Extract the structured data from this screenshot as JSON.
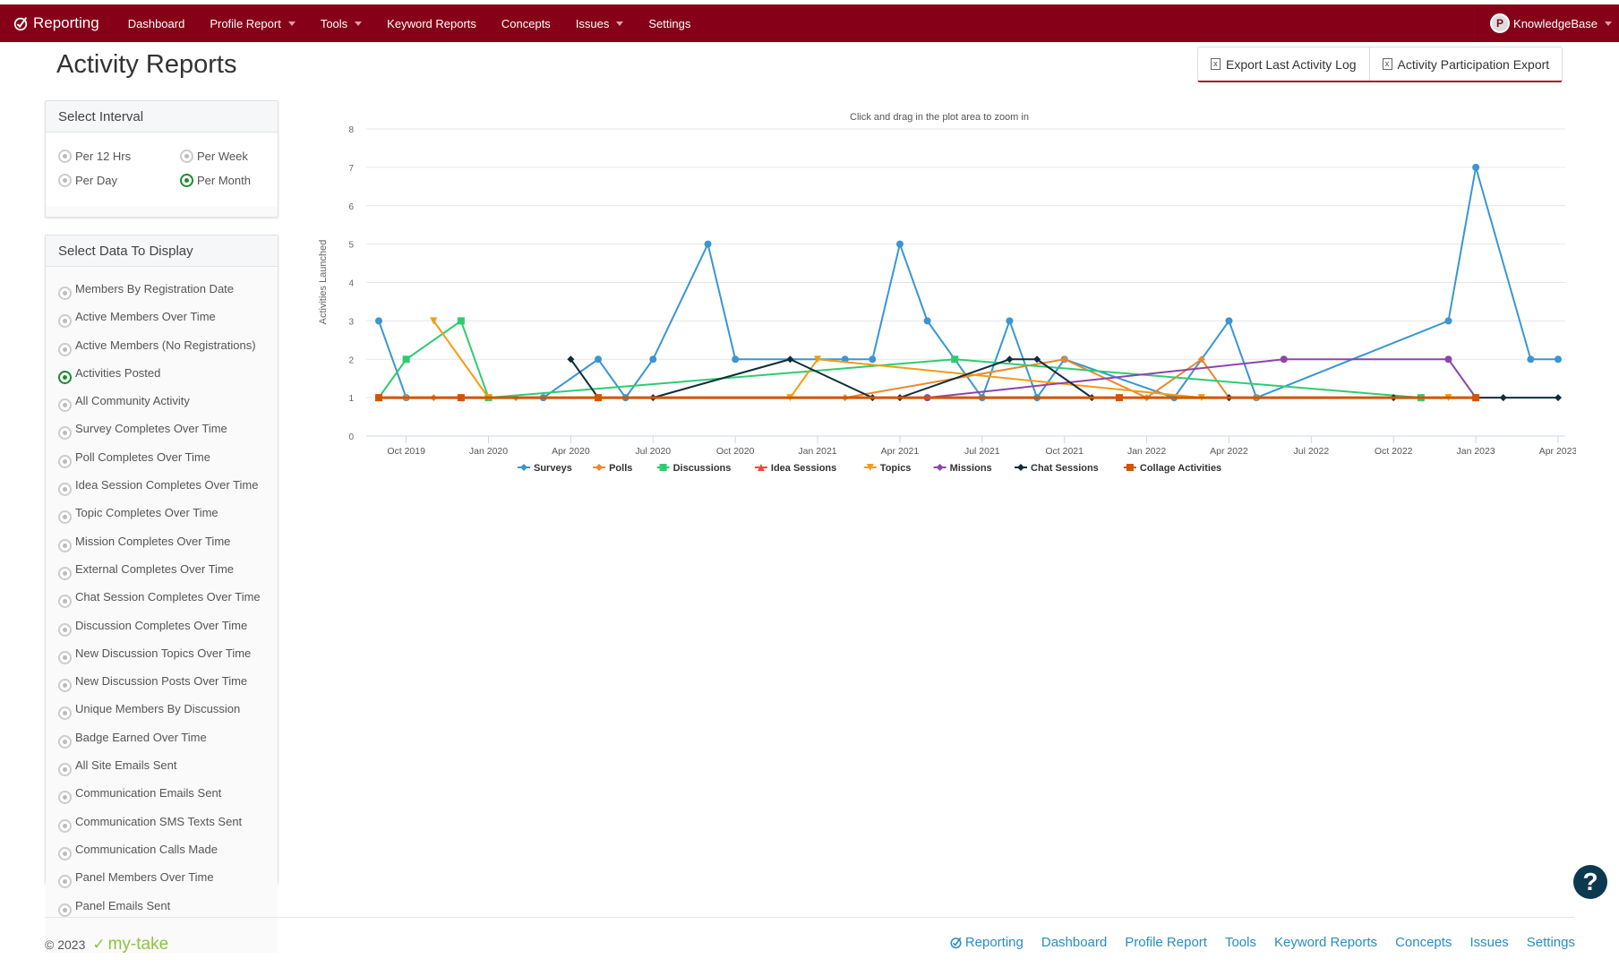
{
  "header": {
    "brand": "Reporting",
    "nav": [
      {
        "label": "Dashboard",
        "dropdown": false
      },
      {
        "label": "Profile Report",
        "dropdown": true
      },
      {
        "label": "Tools",
        "dropdown": true
      },
      {
        "label": "Keyword Reports",
        "dropdown": false
      },
      {
        "label": "Concepts",
        "dropdown": false
      },
      {
        "label": "Issues",
        "dropdown": true
      },
      {
        "label": "Settings",
        "dropdown": false
      }
    ],
    "user": "KnowledgeBase",
    "colors": {
      "bar": "#860018"
    }
  },
  "page": {
    "title": "Activity Reports",
    "export_last_activity": "Export Last Activity Log",
    "activity_participation_export": "Activity Participation Export"
  },
  "interval": {
    "title": "Select Interval",
    "options": [
      {
        "label": "Per 12 Hrs",
        "selected": false
      },
      {
        "label": "Per Week",
        "selected": false
      },
      {
        "label": "Per Day",
        "selected": false
      },
      {
        "label": "Per Month",
        "selected": true
      }
    ]
  },
  "data_select": {
    "title": "Select Data To Display",
    "options": [
      {
        "label": "Members By Registration Date",
        "selected": false
      },
      {
        "label": "Active Members Over Time",
        "selected": false
      },
      {
        "label": "Active Members (No Registrations)",
        "selected": false
      },
      {
        "label": "Activities Posted",
        "selected": true
      },
      {
        "label": "All Community Activity",
        "selected": false
      },
      {
        "label": "Survey Completes Over Time",
        "selected": false
      },
      {
        "label": "Poll Completes Over Time",
        "selected": false
      },
      {
        "label": "Idea Session Completes Over Time",
        "selected": false
      },
      {
        "label": "Topic Completes Over Time",
        "selected": false
      },
      {
        "label": "Mission Completes Over Time",
        "selected": false
      },
      {
        "label": "External Completes Over Time",
        "selected": false
      },
      {
        "label": "Chat Session Completes Over Time",
        "selected": false
      },
      {
        "label": "Discussion Completes Over Time",
        "selected": false
      },
      {
        "label": "New Discussion Topics Over Time",
        "selected": false
      },
      {
        "label": "New Discussion Posts Over Time",
        "selected": false
      },
      {
        "label": "Unique Members By Discussion",
        "selected": false
      },
      {
        "label": "Badge Earned Over Time",
        "selected": false
      },
      {
        "label": "All Site Emails Sent",
        "selected": false
      },
      {
        "label": "Communication Emails Sent",
        "selected": false
      },
      {
        "label": "Communication SMS Texts Sent",
        "selected": false
      },
      {
        "label": "Communication Calls Made",
        "selected": false
      },
      {
        "label": "Panel Members Over Time",
        "selected": false
      },
      {
        "label": "Panel Emails Sent",
        "selected": false
      }
    ]
  },
  "chart_data": {
    "type": "line",
    "title": "",
    "subtitle": "Click and drag in the plot area to zoom in",
    "xlabel": "",
    "ylabel": "Activities Launched",
    "ylim": [
      0,
      8
    ],
    "yticks": [
      0,
      1,
      2,
      3,
      4,
      5,
      6,
      7,
      8
    ],
    "x_start": "Sep 2019",
    "x_end": "Apr 2023",
    "x_unit": "month index from Sep 2019 (0) to Apr 2023 (43)",
    "xrange": [
      0,
      43
    ],
    "xticks": [
      {
        "label": "Oct 2019",
        "x": 1
      },
      {
        "label": "Jan 2020",
        "x": 4
      },
      {
        "label": "Apr 2020",
        "x": 7
      },
      {
        "label": "Jul 2020",
        "x": 10
      },
      {
        "label": "Oct 2020",
        "x": 13
      },
      {
        "label": "Jan 2021",
        "x": 16
      },
      {
        "label": "Apr 2021",
        "x": 19
      },
      {
        "label": "Jul 2021",
        "x": 22
      },
      {
        "label": "Oct 2021",
        "x": 25
      },
      {
        "label": "Jan 2022",
        "x": 28
      },
      {
        "label": "Apr 2022",
        "x": 31
      },
      {
        "label": "Jul 2022",
        "x": 34
      },
      {
        "label": "Oct 2022",
        "x": 37
      },
      {
        "label": "Jan 2023",
        "x": 40
      },
      {
        "label": "Apr 2023",
        "x": 43
      }
    ],
    "grid": true,
    "legend_position": "bottom",
    "series": [
      {
        "name": "Surveys",
        "color": "#3a96d2",
        "marker": "circle",
        "points": [
          [
            0,
            3
          ],
          [
            1,
            1
          ],
          [
            6,
            1
          ],
          [
            8,
            2
          ],
          [
            9,
            1
          ],
          [
            10,
            2
          ],
          [
            12,
            5
          ],
          [
            13,
            2
          ],
          [
            17,
            2
          ],
          [
            18,
            2
          ],
          [
            19,
            5
          ],
          [
            20,
            3
          ],
          [
            22,
            1
          ],
          [
            23,
            3
          ],
          [
            24,
            1
          ],
          [
            25,
            2
          ],
          [
            29,
            1
          ],
          [
            31,
            3
          ],
          [
            32,
            1
          ],
          [
            39,
            3
          ],
          [
            40,
            7
          ],
          [
            42,
            2
          ],
          [
            43,
            2
          ]
        ]
      },
      {
        "name": "Polls",
        "color": "#e8892f",
        "marker": "diamond",
        "points": [
          [
            1,
            1
          ],
          [
            2,
            1
          ],
          [
            5,
            1
          ],
          [
            17,
            1
          ],
          [
            25,
            2
          ],
          [
            28,
            1
          ],
          [
            30,
            2
          ],
          [
            31,
            1
          ],
          [
            32,
            1
          ]
        ]
      },
      {
        "name": "Discussions",
        "color": "#2ecc71",
        "marker": "square",
        "points": [
          [
            0,
            1
          ],
          [
            1,
            2
          ],
          [
            3,
            3
          ],
          [
            4,
            1
          ],
          [
            21,
            2
          ],
          [
            38,
            1
          ]
        ]
      },
      {
        "name": "Idea Sessions",
        "color": "#e74c3c",
        "marker": "triangle",
        "points": []
      },
      {
        "name": "Topics",
        "color": "#f39c12",
        "marker": "triangle-down",
        "points": [
          [
            2,
            3
          ],
          [
            4,
            1
          ],
          [
            15,
            1
          ],
          [
            16,
            2
          ],
          [
            30,
            1
          ],
          [
            39,
            1
          ]
        ]
      },
      {
        "name": "Missions",
        "color": "#8e44ad",
        "marker": "circle",
        "points": [
          [
            20,
            1
          ],
          [
            33,
            2
          ],
          [
            39,
            2
          ],
          [
            40,
            1
          ]
        ]
      },
      {
        "name": "Chat Sessions",
        "color": "#0f2e3d",
        "marker": "diamond",
        "points": [
          [
            7,
            2
          ],
          [
            8,
            1
          ],
          [
            10,
            1
          ],
          [
            15,
            2
          ],
          [
            18,
            1
          ],
          [
            19,
            1
          ],
          [
            23,
            2
          ],
          [
            24,
            2
          ],
          [
            26,
            1
          ],
          [
            31,
            1
          ],
          [
            37,
            1
          ],
          [
            40,
            1
          ],
          [
            41,
            1
          ],
          [
            43,
            1
          ]
        ]
      },
      {
        "name": "Collage Activities",
        "color": "#d35400",
        "marker": "square",
        "points": [
          [
            0,
            1
          ],
          [
            3,
            1
          ],
          [
            8,
            1
          ],
          [
            27,
            1
          ],
          [
            40,
            1
          ]
        ]
      }
    ]
  },
  "footer": {
    "copyright": "© 2023",
    "logo_text": "my-take",
    "links": [
      "Reporting",
      "Dashboard",
      "Profile Report",
      "Tools",
      "Keyword Reports",
      "Concepts",
      "Issues",
      "Settings"
    ]
  },
  "help": {
    "icon": "question-icon",
    "label": "?"
  }
}
